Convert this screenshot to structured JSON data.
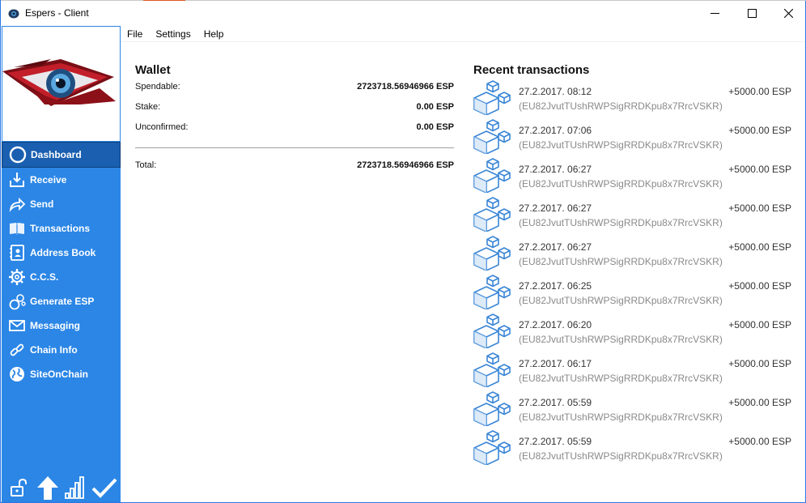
{
  "window": {
    "title": "Espers - Client"
  },
  "menu": {
    "file": "File",
    "settings": "Settings",
    "help": "Help"
  },
  "nav": [
    {
      "label": "Dashboard",
      "icon": "dashboard-icon",
      "active": true
    },
    {
      "label": "Receive",
      "icon": "receive-icon"
    },
    {
      "label": "Send",
      "icon": "send-icon"
    },
    {
      "label": "Transactions",
      "icon": "book-icon"
    },
    {
      "label": "Address Book",
      "icon": "address-book-icon"
    },
    {
      "label": "C.C.S.",
      "icon": "gear-icon"
    },
    {
      "label": "Generate ESP",
      "icon": "coins-icon"
    },
    {
      "label": "Messaging",
      "icon": "envelope-icon"
    },
    {
      "label": "Chain Info",
      "icon": "chain-icon"
    },
    {
      "label": "SiteOnChain",
      "icon": "globe-icon"
    }
  ],
  "wallet": {
    "title": "Wallet",
    "spendable_label": "Spendable:",
    "spendable_value": "2723718.56946966 ESP",
    "stake_label": "Stake:",
    "stake_value": "0.00 ESP",
    "unconfirmed_label": "Unconfirmed:",
    "unconfirmed_value": "0.00 ESP",
    "total_label": "Total:",
    "total_value": "2723718.56946966 ESP"
  },
  "recent": {
    "title": "Recent transactions",
    "items": [
      {
        "date": "27.2.2017. 08:12",
        "address": "(EU82JvutTUshRWPSigRRDKpu8x7RrcVSKR)",
        "amount": "+5000.00 ESP"
      },
      {
        "date": "27.2.2017. 07:06",
        "address": "(EU82JvutTUshRWPSigRRDKpu8x7RrcVSKR)",
        "amount": "+5000.00 ESP"
      },
      {
        "date": "27.2.2017. 06:27",
        "address": "(EU82JvutTUshRWPSigRRDKpu8x7RrcVSKR)",
        "amount": "+5000.00 ESP"
      },
      {
        "date": "27.2.2017. 06:27",
        "address": "(EU82JvutTUshRWPSigRRDKpu8x7RrcVSKR)",
        "amount": "+5000.00 ESP"
      },
      {
        "date": "27.2.2017. 06:27",
        "address": "(EU82JvutTUshRWPSigRRDKpu8x7RrcVSKR)",
        "amount": "+5000.00 ESP"
      },
      {
        "date": "27.2.2017. 06:25",
        "address": "(EU82JvutTUshRWPSigRRDKpu8x7RrcVSKR)",
        "amount": "+5000.00 ESP"
      },
      {
        "date": "27.2.2017. 06:20",
        "address": "(EU82JvutTUshRWPSigRRDKpu8x7RrcVSKR)",
        "amount": "+5000.00 ESP"
      },
      {
        "date": "27.2.2017. 06:17",
        "address": "(EU82JvutTUshRWPSigRRDKpu8x7RrcVSKR)",
        "amount": "+5000.00 ESP"
      },
      {
        "date": "27.2.2017. 05:59",
        "address": "(EU82JvutTUshRWPSigRRDKpu8x7RrcVSKR)",
        "amount": "+5000.00 ESP"
      },
      {
        "date": "27.2.2017. 05:59",
        "address": "(EU82JvutTUshRWPSigRRDKpu8x7RrcVSKR)",
        "amount": "+5000.00 ESP"
      }
    ]
  },
  "status": [
    "unlocked-lock-icon",
    "sync-arrow-icon",
    "signal-bars-icon",
    "checkmark-icon"
  ],
  "colors": {
    "sidebar": "#2b86e6",
    "active": "#1a5fb0",
    "tx_icon": "#3a86d6"
  }
}
